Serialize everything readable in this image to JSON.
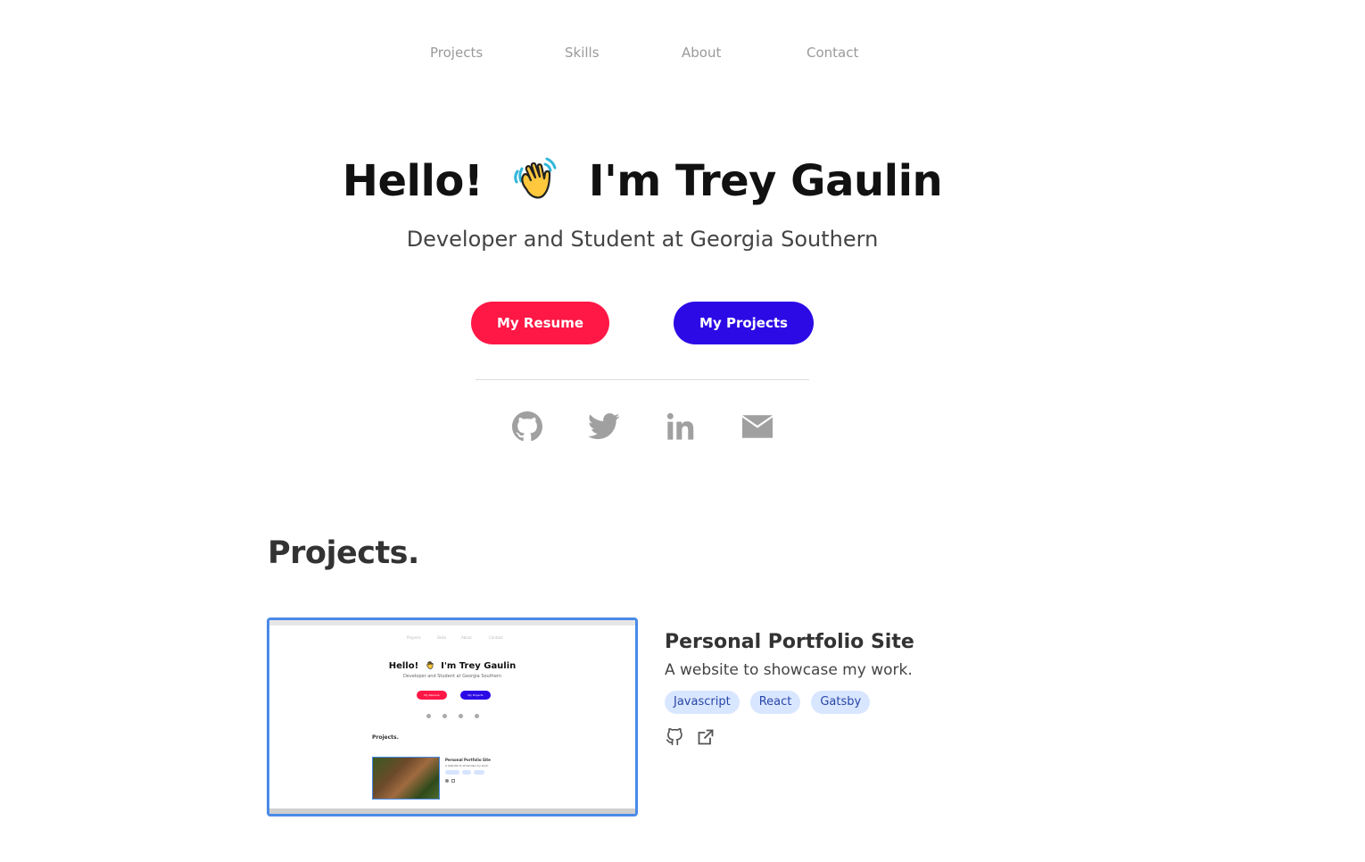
{
  "nav": {
    "items": [
      "Projects",
      "Skills",
      "About",
      "Contact"
    ]
  },
  "hero": {
    "greeting": "Hello!",
    "name_line": "I'm Trey Gaulin",
    "subtitle": "Developer and Student at Georgia Southern",
    "resume_label": "My Resume",
    "projects_label": "My Projects",
    "resume_color": "#ff1745",
    "projects_color": "#2b0ae6"
  },
  "social": {
    "icons": [
      "github-icon",
      "twitter-icon",
      "linkedin-icon",
      "email-icon"
    ],
    "color": "#a0a0a0"
  },
  "projects": {
    "heading": "Projects.",
    "items": [
      {
        "title": "Personal Portfolio Site",
        "description": "A website to showcase my work.",
        "tags": [
          "Javascript",
          "React",
          "Gatsby"
        ],
        "links": [
          "github-icon",
          "external-link-icon"
        ]
      }
    ]
  },
  "preview": {
    "nav": [
      "Projects",
      "Skills",
      "About",
      "Contact"
    ],
    "greeting": "Hello!",
    "name_line": "I'm Trey Gaulin",
    "subtitle": "Developer and Student at Georgia Southern",
    "resume_label": "My Resume",
    "projects_label": "My Projects",
    "projects_heading": "Projects.",
    "project_title": "Personal Portfolio Site",
    "project_description": "A website to showcase my work."
  }
}
